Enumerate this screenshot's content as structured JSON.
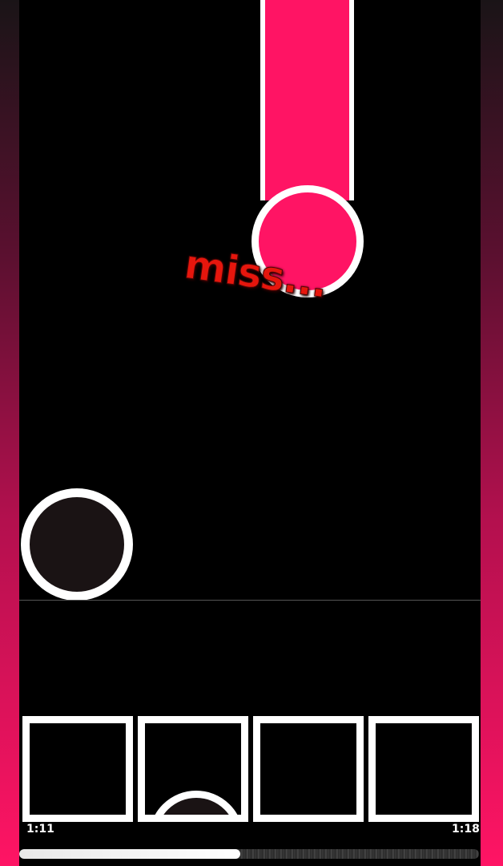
{
  "game": {
    "judgement_text": "miss...",
    "lanes": [
      "lane-1",
      "lane-2",
      "lane-3",
      "lane-4"
    ],
    "time_start": "1:11",
    "time_end": "1:18",
    "progress_fraction": 0.48,
    "colors": {
      "accent": "#ff1464",
      "miss": "#e6160d",
      "note_fill": "#1a1314",
      "outline": "#ffffff"
    }
  }
}
